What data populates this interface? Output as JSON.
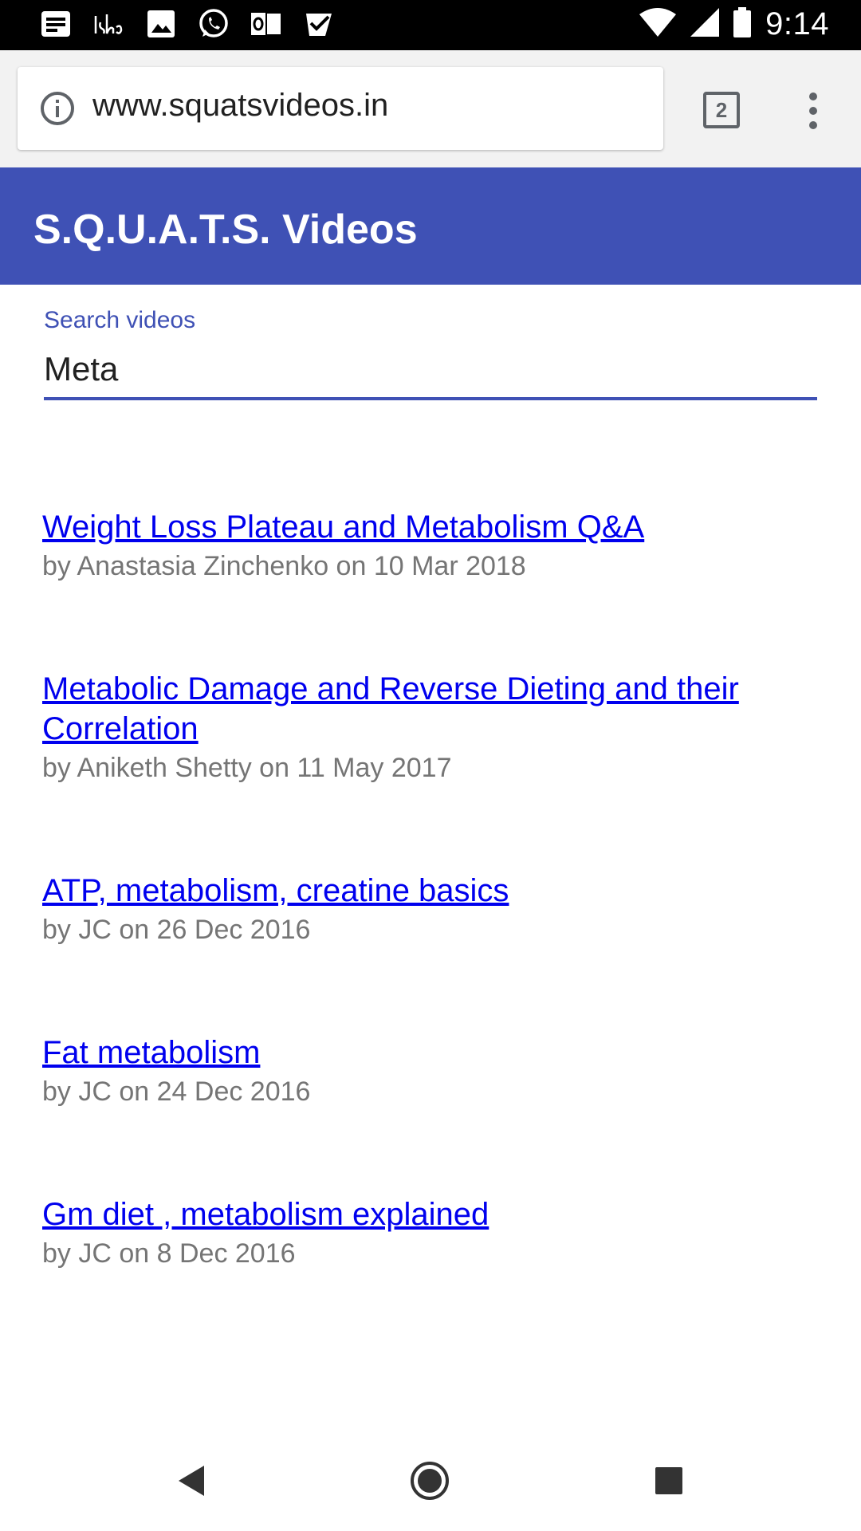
{
  "status_bar": {
    "time": "9:14",
    "left_icons": [
      "notes-icon",
      "isha-icon",
      "image-icon",
      "whatsapp-icon",
      "outlook-icon",
      "checkmark-icon"
    ],
    "right_icons": [
      "wifi-icon",
      "signal-icon",
      "battery-icon"
    ]
  },
  "browser": {
    "url": "www.squatsvideos.in",
    "tab_count": "2",
    "icons": [
      "info-icon",
      "tab-switcher-icon",
      "overflow-menu-icon"
    ]
  },
  "app": {
    "title": "S.Q.U.A.T.S. Videos",
    "header_color": "#3f51b5",
    "link_color": "#0000ee"
  },
  "search": {
    "label": "Search videos",
    "value": "Meta"
  },
  "results": [
    {
      "title": "Weight Loss Plateau and Metabolism Q&A",
      "meta": "by Anastasia Zinchenko on 10 Mar 2018"
    },
    {
      "title": "Metabolic Damage and Reverse Dieting and their Correlation",
      "meta": "by Aniketh Shetty on 11 May 2017"
    },
    {
      "title": "ATP, metabolism, creatine basics",
      "meta": "by JC on 26 Dec 2016"
    },
    {
      "title": "Fat metabolism",
      "meta": "by JC on 24 Dec 2016"
    },
    {
      "title": "Gm diet , metabolism explained",
      "meta": "by JC on 8 Dec 2016"
    }
  ],
  "nav_bar": {
    "icons": [
      "back-icon",
      "home-icon",
      "recents-icon"
    ]
  }
}
